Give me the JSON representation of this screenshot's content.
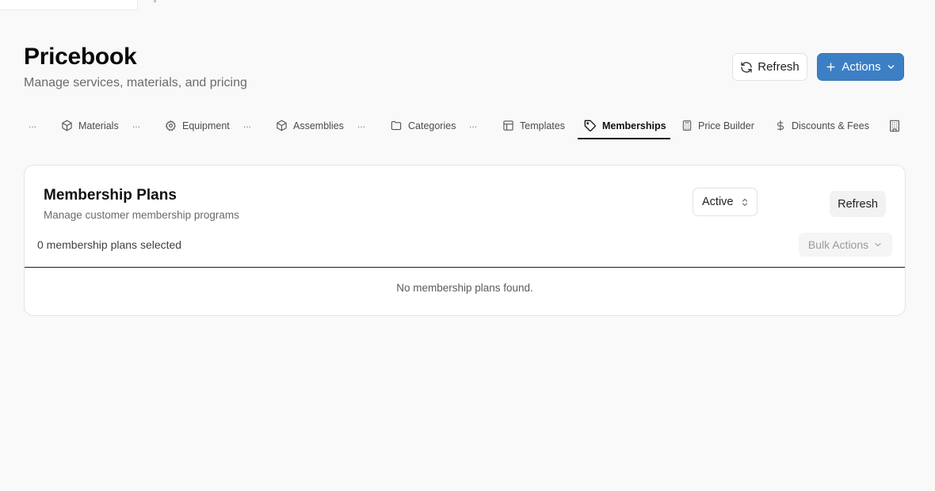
{
  "header": {
    "title": "Pricebook",
    "subtitle": "Manage services, materials, and pricing",
    "refresh_label": "Refresh",
    "actions_label": "Actions"
  },
  "tabs": {
    "overflow_marker": "...",
    "items": [
      {
        "label": "Materials",
        "icon": "cube-icon"
      },
      {
        "label": "Equipment",
        "icon": "gear-icon"
      },
      {
        "label": "Assemblies",
        "icon": "cube-icon"
      },
      {
        "label": "Categories",
        "icon": "folder-icon"
      },
      {
        "label": "Templates",
        "icon": "layout-icon"
      },
      {
        "label": "Memberships",
        "icon": "tag-icon",
        "active": true
      },
      {
        "label": "Price Builder",
        "icon": "calculator-icon"
      },
      {
        "label": "Discounts & Fees",
        "icon": "dollar-icon"
      }
    ]
  },
  "card": {
    "title": "Membership Plans",
    "subtitle": "Manage customer membership programs",
    "status_filter": "Active",
    "refresh_label": "Refresh",
    "selected_text": "0 membership plans selected",
    "bulk_actions_label": "Bulk Actions",
    "empty_message": "No membership plans found."
  },
  "colors": {
    "primary": "#3d7fc4",
    "background": "#f9f9f9"
  }
}
